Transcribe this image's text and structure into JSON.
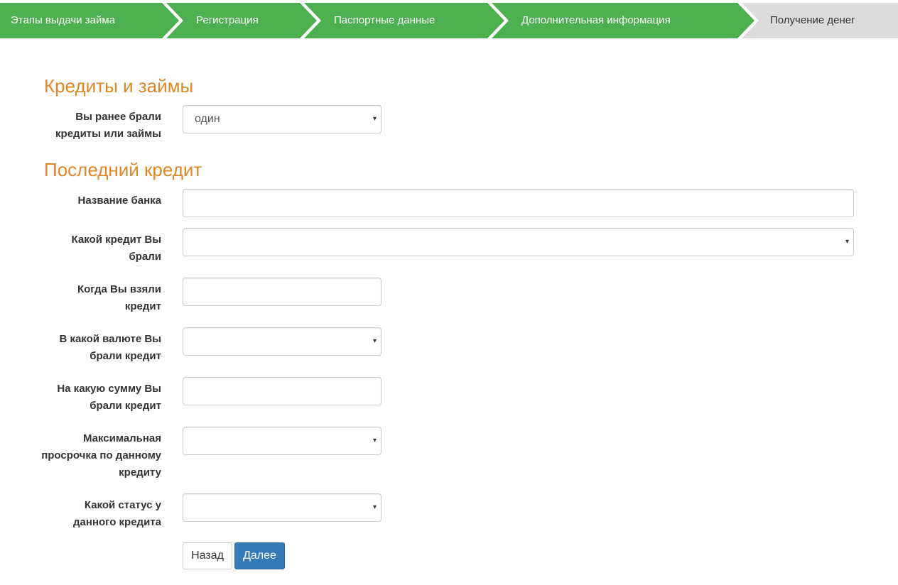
{
  "steps": [
    {
      "label": "Этапы выдачи займа",
      "state": "done"
    },
    {
      "label": "Регистрация",
      "state": "done"
    },
    {
      "label": "Паспортные данные",
      "state": "done"
    },
    {
      "label": "Дополнительная информация",
      "state": "done"
    },
    {
      "label": "Получение денег",
      "state": "current"
    }
  ],
  "colors": {
    "step_done": "#4caf50",
    "step_current": "#dcdcdc",
    "heading": "#e08623",
    "primary": "#337ab7"
  },
  "sections": {
    "credits_title": "Кредиты и займы",
    "last_credit_title": "Последний кредит"
  },
  "form": {
    "previous_credits": {
      "label": "Вы ранее брали кредиты или займы",
      "value": "один"
    },
    "bank_name": {
      "label": "Название банка",
      "value": ""
    },
    "credit_type": {
      "label": "Какой кредит Вы брали",
      "value": ""
    },
    "credit_date": {
      "label": "Когда Вы взяли кредит",
      "value": ""
    },
    "currency": {
      "label": "В какой валюте Вы брали кредит",
      "value": ""
    },
    "amount": {
      "label": "На какую сумму Вы брали кредит",
      "value": ""
    },
    "max_overdue": {
      "label": "Максимальная просрочка по данному кредиту",
      "value": ""
    },
    "status": {
      "label": "Какой статус у данного кредита",
      "value": ""
    }
  },
  "buttons": {
    "back": "Назад",
    "next": "Далее"
  },
  "icons": {
    "select_caret": "▾"
  }
}
